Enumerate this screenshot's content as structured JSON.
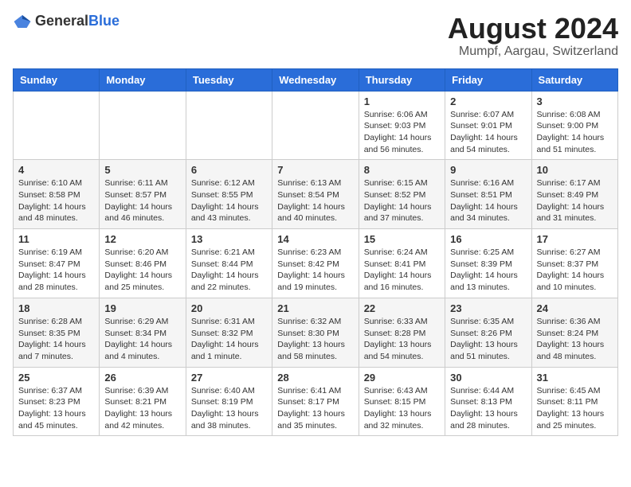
{
  "header": {
    "logo_general": "General",
    "logo_blue": "Blue",
    "main_title": "August 2024",
    "sub_title": "Mumpf, Aargau, Switzerland"
  },
  "calendar": {
    "days_of_week": [
      "Sunday",
      "Monday",
      "Tuesday",
      "Wednesday",
      "Thursday",
      "Friday",
      "Saturday"
    ],
    "weeks": [
      [
        {
          "day": "",
          "info": ""
        },
        {
          "day": "",
          "info": ""
        },
        {
          "day": "",
          "info": ""
        },
        {
          "day": "",
          "info": ""
        },
        {
          "day": "1",
          "info": "Sunrise: 6:06 AM\nSunset: 9:03 PM\nDaylight: 14 hours and 56 minutes."
        },
        {
          "day": "2",
          "info": "Sunrise: 6:07 AM\nSunset: 9:01 PM\nDaylight: 14 hours and 54 minutes."
        },
        {
          "day": "3",
          "info": "Sunrise: 6:08 AM\nSunset: 9:00 PM\nDaylight: 14 hours and 51 minutes."
        }
      ],
      [
        {
          "day": "4",
          "info": "Sunrise: 6:10 AM\nSunset: 8:58 PM\nDaylight: 14 hours and 48 minutes."
        },
        {
          "day": "5",
          "info": "Sunrise: 6:11 AM\nSunset: 8:57 PM\nDaylight: 14 hours and 46 minutes."
        },
        {
          "day": "6",
          "info": "Sunrise: 6:12 AM\nSunset: 8:55 PM\nDaylight: 14 hours and 43 minutes."
        },
        {
          "day": "7",
          "info": "Sunrise: 6:13 AM\nSunset: 8:54 PM\nDaylight: 14 hours and 40 minutes."
        },
        {
          "day": "8",
          "info": "Sunrise: 6:15 AM\nSunset: 8:52 PM\nDaylight: 14 hours and 37 minutes."
        },
        {
          "day": "9",
          "info": "Sunrise: 6:16 AM\nSunset: 8:51 PM\nDaylight: 14 hours and 34 minutes."
        },
        {
          "day": "10",
          "info": "Sunrise: 6:17 AM\nSunset: 8:49 PM\nDaylight: 14 hours and 31 minutes."
        }
      ],
      [
        {
          "day": "11",
          "info": "Sunrise: 6:19 AM\nSunset: 8:47 PM\nDaylight: 14 hours and 28 minutes."
        },
        {
          "day": "12",
          "info": "Sunrise: 6:20 AM\nSunset: 8:46 PM\nDaylight: 14 hours and 25 minutes."
        },
        {
          "day": "13",
          "info": "Sunrise: 6:21 AM\nSunset: 8:44 PM\nDaylight: 14 hours and 22 minutes."
        },
        {
          "day": "14",
          "info": "Sunrise: 6:23 AM\nSunset: 8:42 PM\nDaylight: 14 hours and 19 minutes."
        },
        {
          "day": "15",
          "info": "Sunrise: 6:24 AM\nSunset: 8:41 PM\nDaylight: 14 hours and 16 minutes."
        },
        {
          "day": "16",
          "info": "Sunrise: 6:25 AM\nSunset: 8:39 PM\nDaylight: 14 hours and 13 minutes."
        },
        {
          "day": "17",
          "info": "Sunrise: 6:27 AM\nSunset: 8:37 PM\nDaylight: 14 hours and 10 minutes."
        }
      ],
      [
        {
          "day": "18",
          "info": "Sunrise: 6:28 AM\nSunset: 8:35 PM\nDaylight: 14 hours and 7 minutes."
        },
        {
          "day": "19",
          "info": "Sunrise: 6:29 AM\nSunset: 8:34 PM\nDaylight: 14 hours and 4 minutes."
        },
        {
          "day": "20",
          "info": "Sunrise: 6:31 AM\nSunset: 8:32 PM\nDaylight: 14 hours and 1 minute."
        },
        {
          "day": "21",
          "info": "Sunrise: 6:32 AM\nSunset: 8:30 PM\nDaylight: 13 hours and 58 minutes."
        },
        {
          "day": "22",
          "info": "Sunrise: 6:33 AM\nSunset: 8:28 PM\nDaylight: 13 hours and 54 minutes."
        },
        {
          "day": "23",
          "info": "Sunrise: 6:35 AM\nSunset: 8:26 PM\nDaylight: 13 hours and 51 minutes."
        },
        {
          "day": "24",
          "info": "Sunrise: 6:36 AM\nSunset: 8:24 PM\nDaylight: 13 hours and 48 minutes."
        }
      ],
      [
        {
          "day": "25",
          "info": "Sunrise: 6:37 AM\nSunset: 8:23 PM\nDaylight: 13 hours and 45 minutes."
        },
        {
          "day": "26",
          "info": "Sunrise: 6:39 AM\nSunset: 8:21 PM\nDaylight: 13 hours and 42 minutes."
        },
        {
          "day": "27",
          "info": "Sunrise: 6:40 AM\nSunset: 8:19 PM\nDaylight: 13 hours and 38 minutes."
        },
        {
          "day": "28",
          "info": "Sunrise: 6:41 AM\nSunset: 8:17 PM\nDaylight: 13 hours and 35 minutes."
        },
        {
          "day": "29",
          "info": "Sunrise: 6:43 AM\nSunset: 8:15 PM\nDaylight: 13 hours and 32 minutes."
        },
        {
          "day": "30",
          "info": "Sunrise: 6:44 AM\nSunset: 8:13 PM\nDaylight: 13 hours and 28 minutes."
        },
        {
          "day": "31",
          "info": "Sunrise: 6:45 AM\nSunset: 8:11 PM\nDaylight: 13 hours and 25 minutes."
        }
      ]
    ]
  }
}
